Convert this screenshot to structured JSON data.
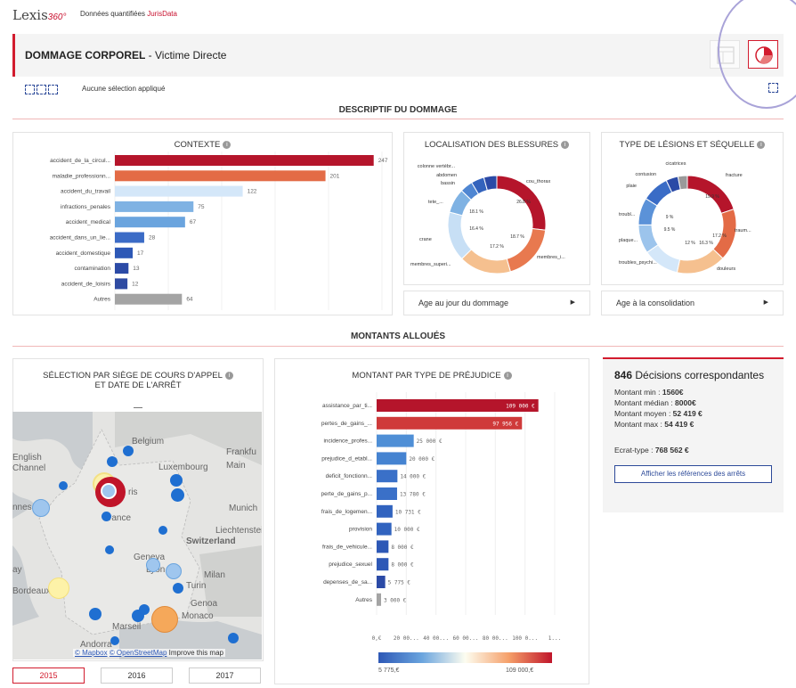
{
  "header": {
    "logo_text": "Lexis",
    "logo_suffix": "360°",
    "subtitle_prefix": "Données quantifiées",
    "subtitle_brand": "JurisData"
  },
  "title": {
    "main": "DOMMAGE CORPOREL",
    "sub": " - Victime Directe"
  },
  "selection": {
    "text": "Aucune sélection appliqué"
  },
  "sections": {
    "descriptif": "DESCRIPTIF DU DOMMAGE",
    "montants": "MONTANTS ALLOUÉS"
  },
  "contexte": {
    "title": "CONTEXTE",
    "info": "i"
  },
  "localisation": {
    "title": "LOCALISATION DES BLESSURES",
    "info": "i",
    "labels": [
      "colonne vertébr...",
      "abdomen",
      "bassin",
      "tete_...",
      "crane",
      "membres_superi...",
      "cou_thorax",
      "membres_i..."
    ],
    "pct": [
      "26.8 %",
      "18.1 %",
      "16.4 %",
      "17.2 %",
      "18.7 %"
    ],
    "select": "Age au jour du dommage"
  },
  "lesions": {
    "title": "TYPE DE LÉSIONS ET SÉQUELLE",
    "info": "i",
    "labels": [
      "cicatrices",
      "contusion",
      "plaie",
      "troubl...",
      "plaque...",
      "troubles_psychi...",
      "fracture",
      "traum...",
      "douleurs"
    ],
    "pct": [
      "19.9 %",
      "17.2 %",
      "9 %",
      "9.5 %",
      "12 %",
      "16.3 %"
    ],
    "select": "Age à la consolidation"
  },
  "siege": {
    "title_line1": "SÉLECTION PAR SIÈGE DE COURS D'APPEL",
    "title_line2": "ET DATE DE L'ARRÊT",
    "dash": "—",
    "info": "i",
    "map_labels": [
      "Belgium",
      "Frankfu",
      "English",
      "Channel",
      "Luxembourg",
      "Main",
      "ris",
      "Munich",
      "rance",
      "Liechtenstein",
      "Switzerland",
      "Geneva",
      "Lyon",
      "Milan",
      "Turin",
      "Genoa",
      "Monaco",
      "Bordeaux",
      "Marseil",
      "Andorra",
      "nnes",
      "ay"
    ],
    "attribution_mapbox": "© Mapbox",
    "attribution_osm": "© OpenStreetMap",
    "attribution_improve": "Improve this map",
    "years": [
      "2015",
      "2016",
      "2017"
    ]
  },
  "montant": {
    "title": "MONTANT PAR TYPE DE PRÉJUDICE",
    "info": "i",
    "xticks": [
      "0,€",
      "20 00...",
      "40 00...",
      "60 00...",
      "80 00...",
      "100 0...",
      "1..."
    ],
    "legend_min": "5 775,€",
    "legend_max": "109 000,€"
  },
  "decisions": {
    "count": "846",
    "count_label": " Décisions correspondantes",
    "rows": [
      {
        "label": "Montant min : ",
        "value": "1560€"
      },
      {
        "label": "Montant médian : ",
        "value": "8000€"
      },
      {
        "label": "Montant moyen : ",
        "value": "52 419 €"
      },
      {
        "label": "Montant max : ",
        "value": "54 419 €"
      }
    ],
    "ecart_label": "Ecrat-type : ",
    "ecart_value": "768 562 €",
    "button": "Afficher les références des arrêts"
  },
  "chart_data": [
    {
      "type": "bar",
      "title": "CONTEXTE",
      "categories": [
        "accident_de_la_circul...",
        "maladie_professionn...",
        "accident_du_travail",
        "infractions_penales",
        "accident_medical",
        "accident_dans_un_lie...",
        "accident_domestique",
        "contamination",
        "accident_de_loisirs",
        "Autres"
      ],
      "values": [
        247,
        201,
        122,
        75,
        67,
        28,
        17,
        13,
        12,
        64
      ],
      "colors": [
        "#b5152b",
        "#e36b46",
        "#d4e7f9",
        "#7fb2e3",
        "#6aa4de",
        "#3b6bc6",
        "#2d58b6",
        "#2b4aa6",
        "#2f4ba2",
        "#a4a4a4"
      ],
      "xlim": [
        0,
        260
      ]
    },
    {
      "type": "pie",
      "title": "LOCALISATION DES BLESSURES",
      "categories": [
        "cou_thorax",
        "membres_inferieurs",
        "membres_superieurs",
        "crane",
        "tete",
        "bassin",
        "abdomen",
        "colonne vertebrale"
      ],
      "values": [
        26.8,
        18.7,
        17.2,
        16.4,
        8.1,
        4.2,
        4.3,
        4.3
      ],
      "colors": [
        "#b5152b",
        "#e8794f",
        "#f5c08f",
        "#c7dff5",
        "#7fb2e3",
        "#4f86d2",
        "#3363bd",
        "#2b4aa6"
      ]
    },
    {
      "type": "pie",
      "title": "TYPE DE LÉSIONS ET SÉQUELLE",
      "categories": [
        "fracture",
        "traumatisme",
        "douleurs",
        "troubles_psychiques",
        "plaque",
        "troubles",
        "plaie",
        "contusion",
        "cicatrices"
      ],
      "values": [
        19.9,
        17.2,
        16.3,
        12,
        9.5,
        9,
        9,
        4,
        3.1
      ],
      "colors": [
        "#b5152b",
        "#e36b46",
        "#f5c08f",
        "#d4e7f9",
        "#9cc4ec",
        "#5b92d8",
        "#3a6cc6",
        "#2b4aa6",
        "#9a9a9a"
      ]
    },
    {
      "type": "bar",
      "title": "MONTANT PAR TYPE DE PRÉJUDICE",
      "categories": [
        "assistance_par_ti...",
        "pertes_de_gains_...",
        "incidence_profes...",
        "prejudice_d_etabl...",
        "deficit_fonctionn...",
        "perte_de_gains_p...",
        "frais_de_logemen...",
        "provision",
        "frais_de_vehicule...",
        "prejudice_sexuel",
        "depenses_de_sa...",
        "Autres"
      ],
      "values": [
        109000,
        97956,
        25000,
        20000,
        14000,
        13780,
        10731,
        10000,
        8000,
        8000,
        5775,
        3000
      ],
      "value_labels": [
        "109 000 €",
        "97 956 €",
        "25 000 €",
        "20 000 €",
        "14 000 €",
        "13 780 €",
        "10 731 €",
        "10 000 €",
        "8 000 €",
        "8 000 €",
        "5 775 €",
        "3 000 €"
      ],
      "colors": [
        "#b5152b",
        "#cf3a3a",
        "#4f8fd6",
        "#4583d1",
        "#3a70c8",
        "#3a70c8",
        "#3163bf",
        "#3163bf",
        "#2d58b6",
        "#2d58b6",
        "#2b4aa6",
        "#a4a4a4"
      ],
      "xlim": [
        0,
        120000
      ]
    }
  ]
}
